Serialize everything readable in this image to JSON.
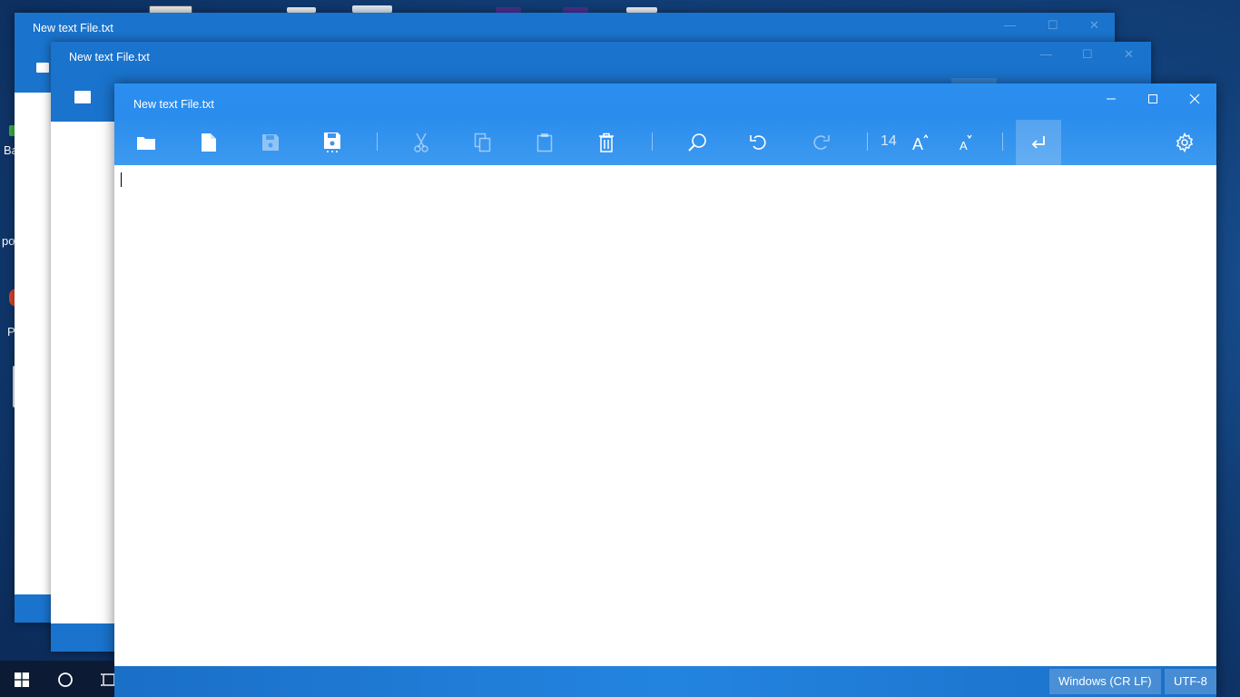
{
  "desktop": {
    "fragments": [
      "Ba",
      "po",
      "P"
    ]
  },
  "background_windows": [
    {
      "title": "New text File.txt"
    },
    {
      "title": "New text File.txt"
    }
  ],
  "window": {
    "title": "New text File.txt",
    "accent": "#2a8cec",
    "controls": {
      "minimize": "minimize-icon",
      "maximize": "maximize-icon",
      "close": "close-icon"
    }
  },
  "toolbar": {
    "buttons": [
      {
        "name": "open",
        "icon": "folder-icon",
        "enabled": true
      },
      {
        "name": "new",
        "icon": "new-file-icon",
        "enabled": true
      },
      {
        "name": "save",
        "icon": "save-icon",
        "enabled": false
      },
      {
        "name": "save-as",
        "icon": "save-as-icon",
        "enabled": true
      },
      {
        "name": "cut",
        "icon": "cut-icon",
        "enabled": false
      },
      {
        "name": "copy",
        "icon": "copy-icon",
        "enabled": false
      },
      {
        "name": "paste",
        "icon": "paste-icon",
        "enabled": false
      },
      {
        "name": "delete",
        "icon": "trash-icon",
        "enabled": true
      },
      {
        "name": "find",
        "icon": "search-icon",
        "enabled": true
      },
      {
        "name": "undo",
        "icon": "undo-icon",
        "enabled": true
      },
      {
        "name": "redo",
        "icon": "redo-icon",
        "enabled": false
      },
      {
        "name": "increase-font",
        "icon": "font-increase-icon",
        "enabled": true
      },
      {
        "name": "decrease-font",
        "icon": "font-decrease-icon",
        "enabled": true
      },
      {
        "name": "word-wrap",
        "icon": "wrap-icon",
        "enabled": true,
        "active": true
      },
      {
        "name": "settings",
        "icon": "gear-icon",
        "enabled": true
      }
    ],
    "font_size": "14"
  },
  "editor": {
    "content": ""
  },
  "statusbar": {
    "line_ending": "Windows (CR LF)",
    "encoding": "UTF-8"
  }
}
